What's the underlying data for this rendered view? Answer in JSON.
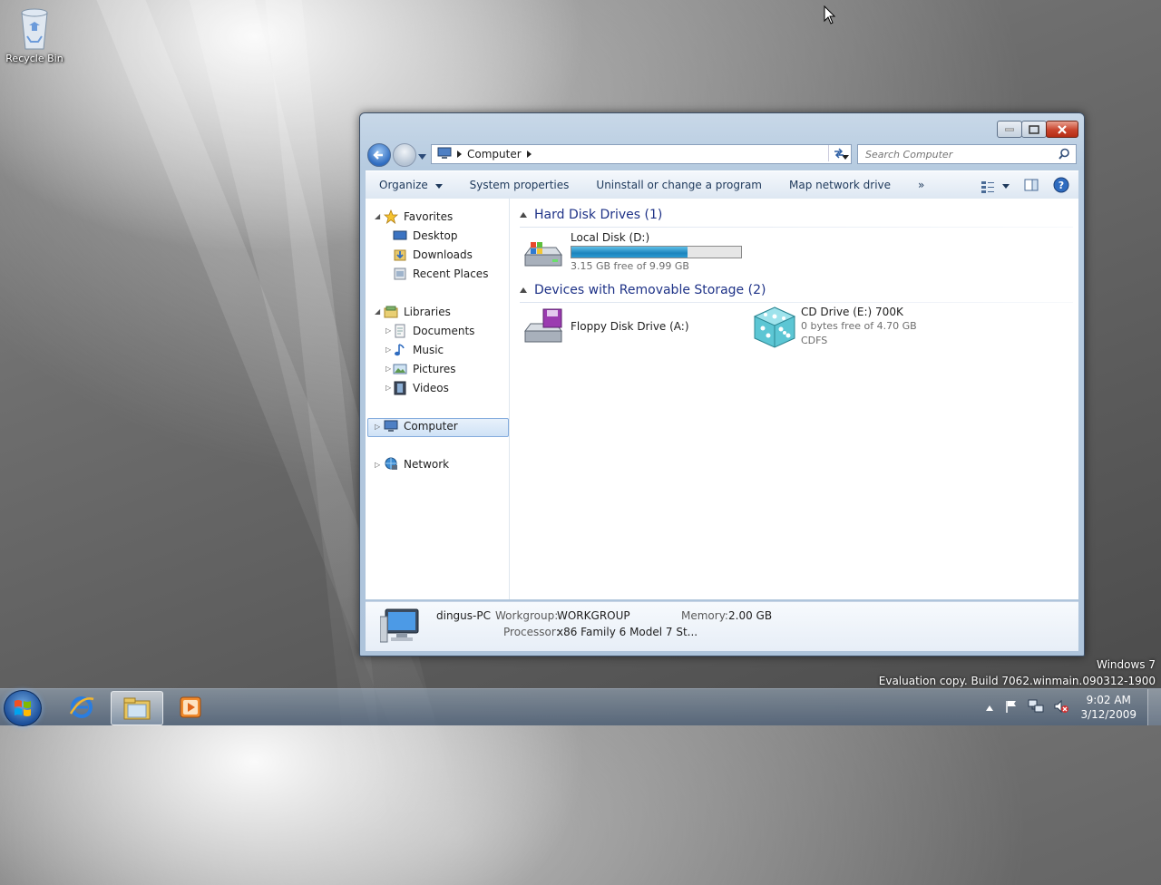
{
  "desktop": {
    "recycle_bin_label": "Recycle Bin"
  },
  "window": {
    "address": {
      "crumb": "Computer"
    },
    "search": {
      "placeholder": "Search Computer"
    },
    "toolbar": {
      "organize": "Organize",
      "system_properties": "System properties",
      "uninstall": "Uninstall or change a program",
      "map_drive": "Map network drive",
      "more": "»"
    },
    "nav": {
      "favorites": "Favorites",
      "desktop": "Desktop",
      "downloads": "Downloads",
      "recent_places": "Recent Places",
      "libraries": "Libraries",
      "documents": "Documents",
      "music": "Music",
      "pictures": "Pictures",
      "videos": "Videos",
      "computer": "Computer",
      "network": "Network"
    },
    "groups": {
      "hdd_header": "Hard Disk Drives (1)",
      "removable_header": "Devices with Removable Storage (2)"
    },
    "drives": {
      "local_disk": {
        "name": "Local Disk (D:)",
        "free": "3.15 GB free of 9.99 GB",
        "used_fraction": 0.685
      },
      "floppy": {
        "name": "Floppy Disk Drive (A:)"
      },
      "cd": {
        "name": "CD Drive (E:) 700K",
        "free": "0 bytes free of 4.70 GB",
        "fs": "CDFS"
      }
    },
    "details": {
      "computer_name": "dingus-PC",
      "workgroup_label": "Workgroup:",
      "workgroup": "WORKGROUP",
      "memory_label": "Memory:",
      "memory": "2.00 GB",
      "processor_label": "Processor:",
      "processor": "x86 Family 6 Model 7 St..."
    }
  },
  "watermark": {
    "line1": "Windows 7",
    "line2": "Evaluation copy. Build 7062.winmain.090312-1900"
  },
  "taskbar": {
    "time": "9:02 AM",
    "date": "3/12/2009"
  },
  "colors": {
    "accent": "#1e3287",
    "progress": "#1d84bd",
    "selection": "#cfe2f6"
  }
}
